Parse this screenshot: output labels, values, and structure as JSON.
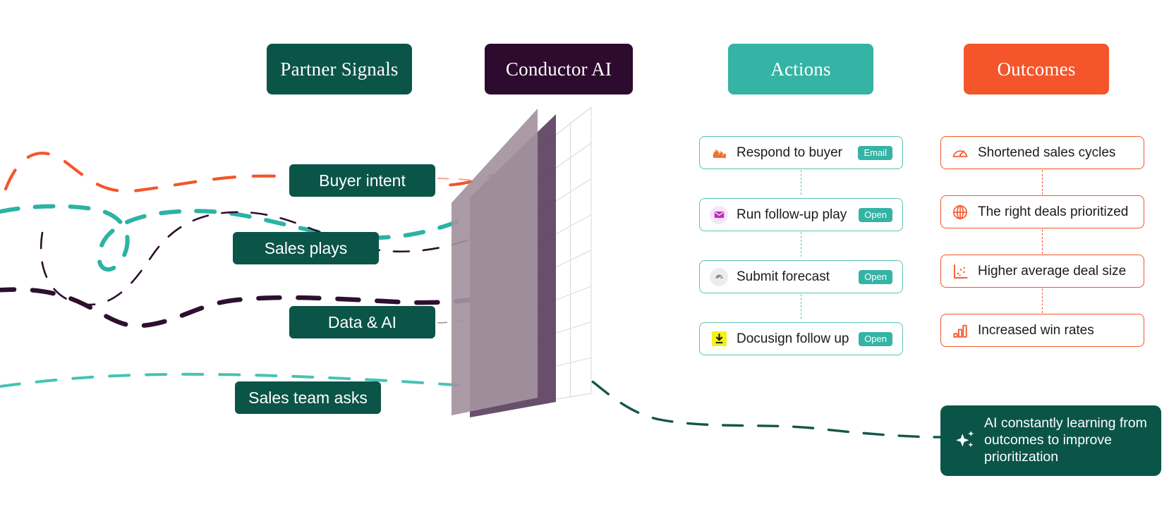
{
  "columns": {
    "partner_signals": {
      "label": "Partner Signals",
      "color": "#0B5448"
    },
    "conductor": {
      "label": "Conductor AI",
      "color": "#2D0B2E"
    },
    "actions": {
      "label": "Actions",
      "color": "#35B3A4"
    },
    "outcomes": {
      "label": "Outcomes",
      "color": "#F4552B"
    }
  },
  "signals": [
    {
      "label": "Buyer intent",
      "stream_color": "#F4552B"
    },
    {
      "label": "Sales plays",
      "stream_color": "#2BB3A3"
    },
    {
      "label": "Data & AI",
      "stream_color": "#2D0F2E"
    },
    {
      "label": "Sales team asks",
      "stream_color": "#45C3B4"
    }
  ],
  "actions": [
    {
      "icon": "flame-icon",
      "label": "Respond to buyer",
      "badge": "Email"
    },
    {
      "icon": "envelope-icon",
      "label": "Run follow-up play",
      "badge": "Open"
    },
    {
      "icon": "gauge-icon",
      "label": "Submit forecast",
      "badge": "Open"
    },
    {
      "icon": "docusign-icon",
      "label": "Docusign follow up",
      "badge": "Open"
    }
  ],
  "outcomes": [
    {
      "icon": "speedometer-icon",
      "label": "Shortened sales cycles"
    },
    {
      "icon": "target-globe-icon",
      "label": "The right deals prioritized"
    },
    {
      "icon": "scatter-chart-icon",
      "label": "Higher average deal size"
    },
    {
      "icon": "bar-chart-icon",
      "label": "Increased win rates"
    }
  ],
  "learning_callout": {
    "icon": "sparkle-icon",
    "line1": "AI constantly learning from",
    "line2": "outcomes to improve",
    "line3": "prioritization",
    "background": "#0B5448"
  },
  "planes": {
    "front_fill": "#A4939F",
    "middle_fill": "#5C4260",
    "back_grid_stroke": "#D8D8DC"
  }
}
